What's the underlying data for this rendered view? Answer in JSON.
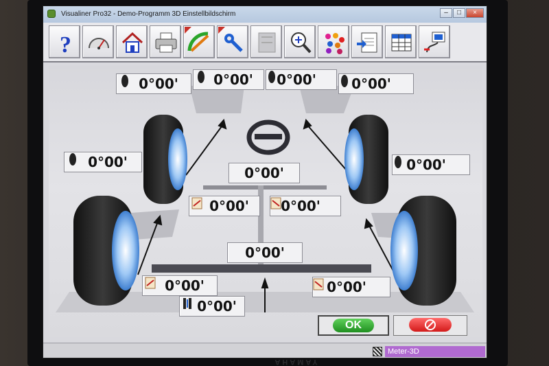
{
  "window": {
    "title": "Visualiner Pro32 - Demo-Programm   3D Einstellbildschirm",
    "controls": {
      "minimize": "–",
      "maximize": "□",
      "close": "×"
    }
  },
  "toolbar": {
    "buttons": [
      {
        "name": "help-button",
        "icon": "help-icon",
        "label": "?"
      },
      {
        "name": "gauge-button",
        "icon": "gauge-icon"
      },
      {
        "name": "home-button",
        "icon": "home-icon"
      },
      {
        "name": "print-button",
        "icon": "printer-icon"
      },
      {
        "name": "adjust-button",
        "icon": "ruler-pencil-icon"
      },
      {
        "name": "wrench-button",
        "icon": "wrench-icon"
      },
      {
        "name": "measure-button",
        "icon": "measure-icon"
      },
      {
        "name": "zoom-button",
        "icon": "zoom-icon"
      },
      {
        "name": "colors-button",
        "icon": "dots-icon"
      },
      {
        "name": "document-button",
        "icon": "document-icon"
      },
      {
        "name": "table-button",
        "icon": "table-icon"
      },
      {
        "name": "sensor-button",
        "icon": "sensor-icon"
      }
    ]
  },
  "readings": {
    "front_left_camber": "0°00'",
    "front_left_toe": "0°00'",
    "front_right_toe": "0°00'",
    "front_right_camber": "0°00'",
    "left_side_camber": "0°00'",
    "right_side_camber": "0°00'",
    "steering": "0°00'",
    "front_left_axle": "0°00'",
    "front_right_axle": "0°00'",
    "center": "0°00'",
    "rear_left": "0°00'",
    "rear_right": "0°00'",
    "thrust": "0°00'"
  },
  "actions": {
    "ok_label": "OK"
  },
  "statusbar": {
    "meter_label": "Meter-3D"
  },
  "monitor": {
    "brand": "YAMAHA"
  },
  "colors": {
    "ok_green": "#2aa52a",
    "cancel_red": "#e02020",
    "status_purple": "#b06ad0",
    "arrow": "#111111"
  }
}
